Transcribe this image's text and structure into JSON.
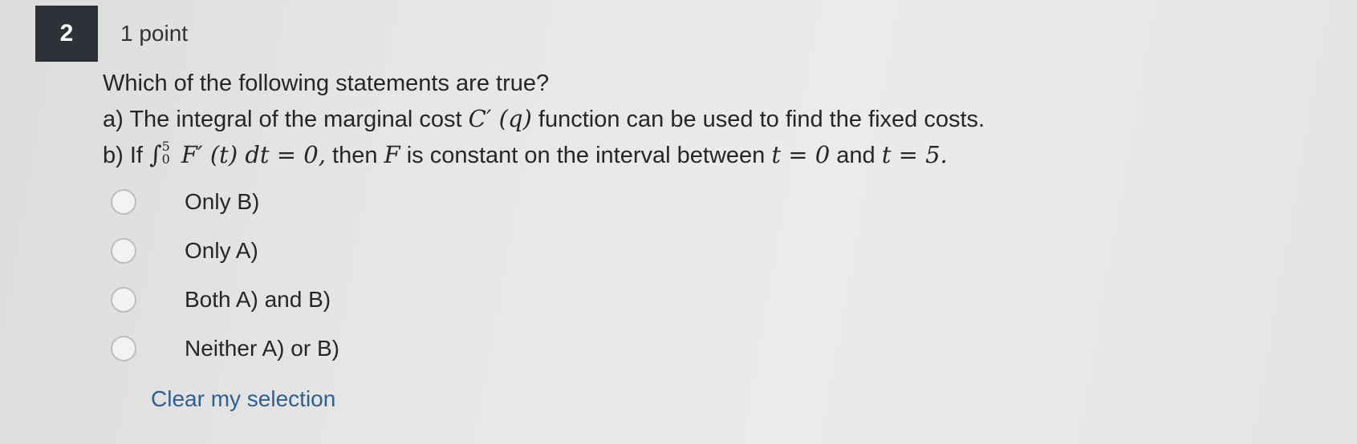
{
  "question_number": "2",
  "points": "1 point",
  "prompt": "Which of the following statements are true?",
  "statement_a": {
    "prefix": "a) The integral of the marginal cost",
    "math": "C′ (q)",
    "suffix": "function can be used to find the fixed costs."
  },
  "statement_b": {
    "prefix": "b) If",
    "integral_sign": "∫",
    "upper_limit": "5",
    "lower_limit": "0",
    "integrand": "F′ (t) dt = 0,",
    "middle": "then",
    "var_f": "F",
    "middle2": "is constant on the interval between",
    "cond1": "t = 0",
    "and": "and",
    "cond2": "t = 5."
  },
  "options": [
    {
      "label": "Only B)"
    },
    {
      "label": "Only A)"
    },
    {
      "label": "Both A) and B)"
    },
    {
      "label": "Neither A) or B)"
    }
  ],
  "clear_label": "Clear my selection",
  "colors": {
    "badge_bg": "#2c3238",
    "link": "#2e5f93"
  }
}
